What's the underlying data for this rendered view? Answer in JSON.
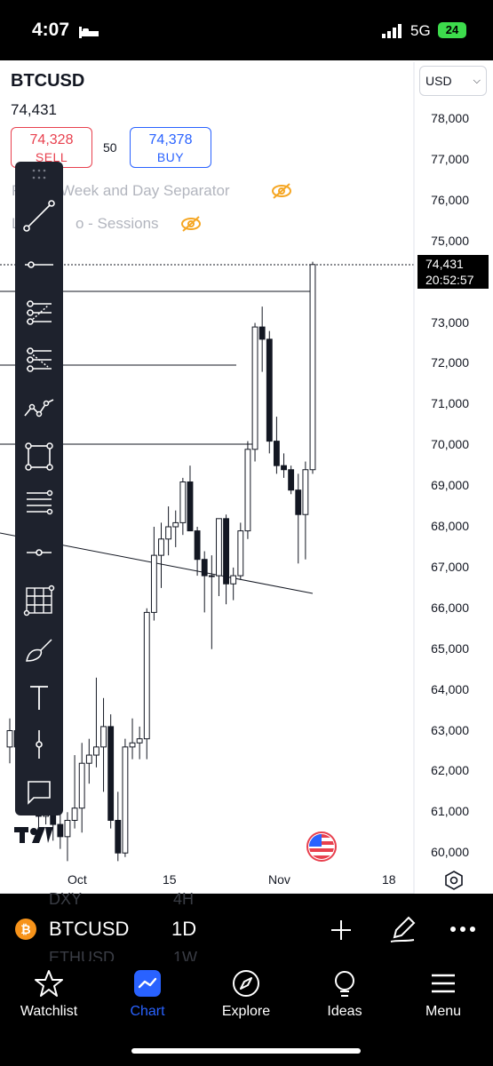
{
  "status_bar": {
    "time": "4:07",
    "network": "5G",
    "battery": "24"
  },
  "header": {
    "symbol": "BTCUSD",
    "last_price": "74,431",
    "sell_price": "74,328",
    "sell_label": "SELL",
    "spread": "50",
    "buy_price": "74,378",
    "buy_label": "BUY",
    "currency": "USD"
  },
  "indicators": [
    {
      "label": "Week and Day Separator",
      "label_prefix": "F"
    },
    {
      "label": "o - Sessions",
      "label_prefix": "L"
    }
  ],
  "chart_data": {
    "type": "candlestick",
    "interval": "1D",
    "y_ticks": [
      "78,000",
      "77,000",
      "76,000",
      "75,000",
      "74,000",
      "73,000",
      "72,000",
      "71,000",
      "70,000",
      "69,000",
      "68,000",
      "67,000",
      "66,000",
      "65,000",
      "64,000",
      "63,000",
      "62,000",
      "61,000",
      "60,000"
    ],
    "x_ticks": [
      "Oct",
      "15",
      "Nov",
      "18"
    ],
    "current_price": "74,431",
    "countdown": "20:52:57",
    "candles": [
      [
        62600,
        63300,
        62200,
        63000
      ],
      [
        63000,
        63700,
        62300,
        62600
      ],
      [
        62600,
        66000,
        62300,
        65900
      ],
      [
        65900,
        66200,
        64100,
        64600
      ],
      [
        64600,
        64600,
        60400,
        60900
      ],
      [
        60900,
        62900,
        60700,
        62700
      ],
      [
        62700,
        63300,
        60300,
        60700
      ],
      [
        60700,
        61200,
        60100,
        60400
      ],
      [
        60400,
        61000,
        59800,
        60800
      ],
      [
        60800,
        62400,
        60600,
        61100
      ],
      [
        61100,
        62700,
        60500,
        62200
      ],
      [
        62200,
        62800,
        61700,
        62400
      ],
      [
        62400,
        64300,
        62100,
        62600
      ],
      [
        62600,
        63800,
        61500,
        63100
      ],
      [
        63100,
        63400,
        60600,
        60800
      ],
      [
        60800,
        61500,
        59800,
        60000
      ],
      [
        60000,
        62800,
        59900,
        62600
      ],
      [
        62600,
        63300,
        62300,
        62700
      ],
      [
        62700,
        63100,
        62300,
        62800
      ],
      [
        62800,
        66000,
        62300,
        65900
      ],
      [
        65900,
        68000,
        65700,
        67300
      ],
      [
        67300,
        68100,
        66500,
        67700
      ],
      [
        67700,
        68500,
        67300,
        68000
      ],
      [
        68000,
        68400,
        67500,
        68100
      ],
      [
        68100,
        69200,
        67800,
        69100
      ],
      [
        69100,
        69500,
        67900,
        67900
      ],
      [
        67900,
        68000,
        66800,
        67200
      ],
      [
        67200,
        67400,
        65900,
        66800
      ],
      [
        66800,
        67300,
        65000,
        66800
      ],
      [
        66800,
        68200,
        66300,
        68200
      ],
      [
        68200,
        68300,
        66100,
        66600
      ],
      [
        66600,
        67000,
        66200,
        66800
      ],
      [
        66800,
        68100,
        66700,
        67900
      ],
      [
        67900,
        70100,
        67700,
        69900
      ],
      [
        69900,
        73000,
        69600,
        72900
      ],
      [
        72900,
        73400,
        71800,
        72600
      ],
      [
        72600,
        72800,
        69800,
        70100
      ],
      [
        70100,
        70700,
        69300,
        69500
      ],
      [
        69500,
        69800,
        69200,
        69400
      ],
      [
        69400,
        69500,
        68800,
        68900
      ],
      [
        68900,
        69300,
        67100,
        68300
      ],
      [
        68300,
        69600,
        67200,
        69400
      ],
      [
        69400,
        74500,
        69300,
        74431
      ]
    ],
    "grid": false
  },
  "bottom_bar": {
    "symbol": "BTCUSD",
    "interval": "1D",
    "ghost_symbol_1": "DXY",
    "ghost_interval_1": "4H",
    "ghost_symbol_2": "ETHUSD",
    "ghost_interval_2": "1W"
  },
  "tabs": [
    {
      "label": "Watchlist",
      "icon": "star-icon"
    },
    {
      "label": "Chart",
      "icon": "chart-icon"
    },
    {
      "label": "Explore",
      "icon": "compass-icon"
    },
    {
      "label": "Ideas",
      "icon": "lightbulb-icon"
    },
    {
      "label": "Menu",
      "icon": "menu-icon"
    }
  ],
  "colors": {
    "sell": "#e8404e",
    "buy": "#2962ff",
    "accent": "#2962ff",
    "bitcoin": "#f7931a",
    "indicator_eye": "#f5a623"
  }
}
